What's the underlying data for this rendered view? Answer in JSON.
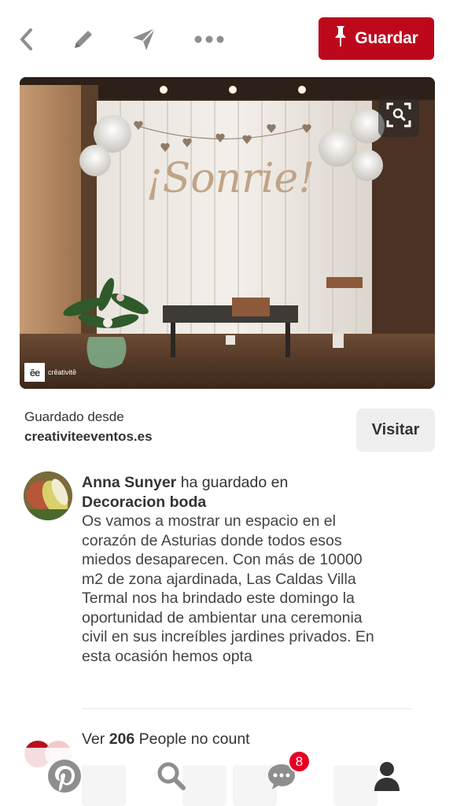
{
  "toolbar": {
    "save_label": "Guardar",
    "icons": [
      "back-icon",
      "edit-icon",
      "send-icon",
      "more-icon",
      "pin-icon"
    ]
  },
  "image": {
    "sign_text": "¡Sonrie!",
    "watermark_logo": "ēe",
    "watermark_text": "crēativitē"
  },
  "source": {
    "label": "Guardado desde",
    "domain": "creativiteeventos.es",
    "visit_label": "Visitar"
  },
  "saver": {
    "name": "Anna Sunyer",
    "action": " ha guardado en",
    "board": "Decoracion boda",
    "description": "Os vamos a mostrar un espacio en el corazón de Asturias donde todos esos miedos desaparecen. Con más de 10000 m2 de zona ajardinada, Las Caldas Villa Termal nos ha brindado este domingo la oportunidad de ambientar una ceremonia civil en sus increíbles jardines privados. En esta ocasión hemos opta"
  },
  "people": {
    "prefix": "Ver ",
    "count": "206",
    "suffix": " People  no  count"
  },
  "nav": {
    "items": [
      "home-icon",
      "search-icon",
      "messages-icon",
      "profile-icon"
    ],
    "messages_badge": "8"
  },
  "colors": {
    "accent": "#bd081c",
    "icon_gray": "#8e8e8e",
    "active": "#333333"
  }
}
